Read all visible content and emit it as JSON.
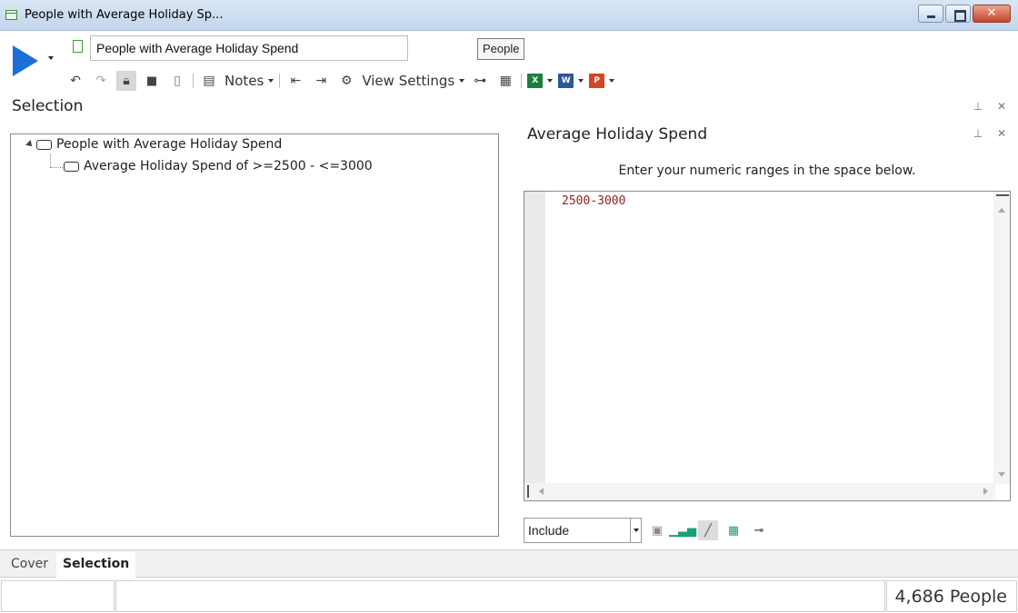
{
  "window": {
    "title": "People with Average Holiday Sp..."
  },
  "header": {
    "selection_name": "People with Average Holiday Spend",
    "system_badge": "People"
  },
  "toolbar": {
    "notes_label": "Notes",
    "view_settings_label": "View Settings",
    "excel_glyph": "X",
    "word_glyph": "W",
    "powerpoint_glyph": "P"
  },
  "left_panel": {
    "title": "Selection",
    "tree": [
      {
        "label": "People with Average Holiday Spend",
        "level": 0
      },
      {
        "label": "Average Holiday Spend of >=2500 - <=3000",
        "level": 1
      }
    ]
  },
  "right_panel": {
    "title": "Average Holiday Spend",
    "hint": "Enter your numeric ranges in the space below.",
    "ranges_text": "2500-3000",
    "include_option": "Include"
  },
  "tabs": [
    {
      "label": "Cover",
      "active": false
    },
    {
      "label": "Selection",
      "active": true
    }
  ],
  "status": {
    "count": "4,686 People"
  },
  "colors": {
    "run_button": "#1f6fd8",
    "range_text": "#9a1a1a",
    "title_bar": "#c4d6ec"
  },
  "icons": [
    "window-icon",
    "run-icon",
    "document-icon",
    "undo-icon",
    "redo-icon",
    "lock-icon",
    "save-icon",
    "database-icon",
    "notes-icon",
    "outdent-icon",
    "indent-icon",
    "settings-icon",
    "tree-view-icon",
    "grid-view-icon",
    "excel-icon",
    "word-icon",
    "powerpoint-icon",
    "pin-icon",
    "close-icon"
  ]
}
